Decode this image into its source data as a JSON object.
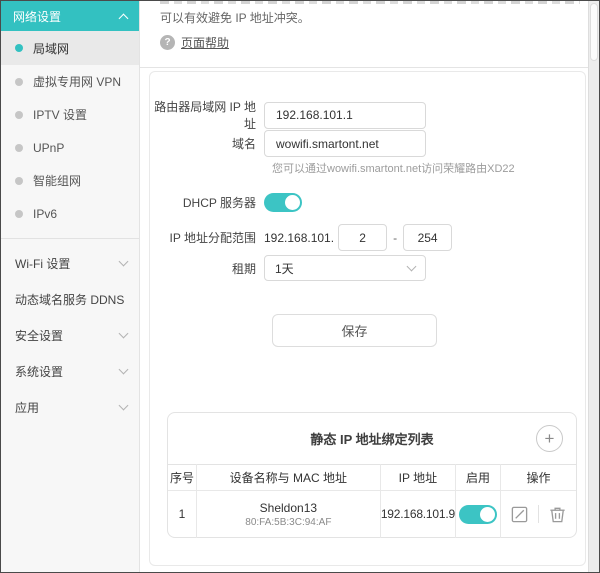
{
  "colors": {
    "accent": "#33c1c1",
    "sidebar_bg": "#f7f7f7",
    "active_item_bg": "#e9e9e9"
  },
  "sidebar": {
    "header": {
      "label": "网络设置"
    },
    "items": [
      {
        "label": "局域网",
        "active": true
      },
      {
        "label": "虚拟专用网 VPN",
        "active": false
      },
      {
        "label": "IPTV 设置",
        "active": false
      },
      {
        "label": "UPnP",
        "active": false
      },
      {
        "label": "智能组网",
        "active": false
      },
      {
        "label": "IPv6",
        "active": false
      }
    ],
    "groups": [
      {
        "label": "Wi-Fi 设置",
        "chevron": true
      },
      {
        "label": "动态域名服务 DDNS",
        "chevron": false
      },
      {
        "label": "安全设置",
        "chevron": true
      },
      {
        "label": "系统设置",
        "chevron": true
      },
      {
        "label": "应用",
        "chevron": true
      }
    ]
  },
  "top": {
    "description": "可以有效避免 IP 地址冲突。",
    "help_icon": "question-circle",
    "help_link": "页面帮助"
  },
  "form": {
    "lan_ip": {
      "label": "路由器局域网 IP 地址",
      "value": "192.168.101.1"
    },
    "domain": {
      "label": "域名",
      "value": "wowifi.smartont.net",
      "hint": "您可以通过wowifi.smartont.net访问荣耀路由XD22"
    },
    "dhcp": {
      "label": "DHCP 服务器",
      "enabled": true
    },
    "ip_range": {
      "label": "IP 地址分配范围",
      "prefix": "192.168.101.",
      "start": "2",
      "separator": "-",
      "end": "254"
    },
    "lease": {
      "label": "租期",
      "value": "1天"
    },
    "save_label": "保存"
  },
  "static_binding": {
    "title": "静态 IP 地址绑定列表",
    "add_icon": "+",
    "columns": [
      "序号",
      "设备名称与 MAC 地址",
      "IP 地址",
      "启用",
      "操作"
    ],
    "rows": [
      {
        "index": "1",
        "device_name": "Sheldon13",
        "mac": "80:FA:5B:3C:94:AF",
        "ip": "192.168.101.9",
        "enabled": true
      }
    ]
  }
}
